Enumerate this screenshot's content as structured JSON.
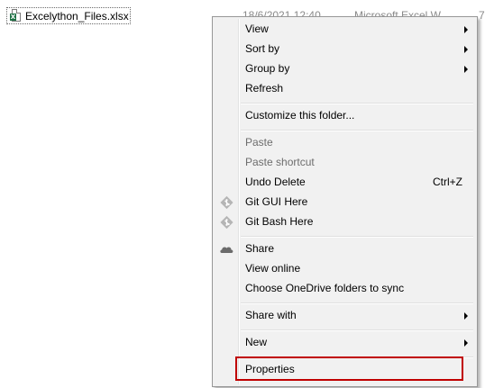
{
  "file_row": {
    "name": "Excelython_Files.xlsx",
    "date": "18/6/2021 12:40 ...",
    "type": "Microsoft Excel W...",
    "size": "7"
  },
  "context_menu": {
    "items": [
      {
        "label": "View",
        "submenu": true
      },
      {
        "label": "Sort by",
        "submenu": true
      },
      {
        "label": "Group by",
        "submenu": true
      },
      {
        "label": "Refresh"
      },
      {
        "label": "Customize this folder..."
      },
      {
        "label": "Paste",
        "disabled": true
      },
      {
        "label": "Paste shortcut",
        "disabled": true
      },
      {
        "label": "Undo Delete",
        "shortcut": "Ctrl+Z"
      },
      {
        "label": "Git GUI Here",
        "icon": "git-icon"
      },
      {
        "label": "Git Bash Here",
        "icon": "git-icon"
      },
      {
        "label": "Share",
        "icon": "onedrive-cloud-icon"
      },
      {
        "label": "View online"
      },
      {
        "label": "Choose OneDrive folders to sync"
      },
      {
        "label": "Share with",
        "submenu": true
      },
      {
        "label": "New",
        "submenu": true
      },
      {
        "label": "Properties",
        "highlighted": true
      }
    ]
  },
  "colors": {
    "highlight_border": "#c00000",
    "menu_background": "#f1f1f1",
    "disabled_text": "#6d6d6d",
    "excel_green": "#1e7145"
  }
}
